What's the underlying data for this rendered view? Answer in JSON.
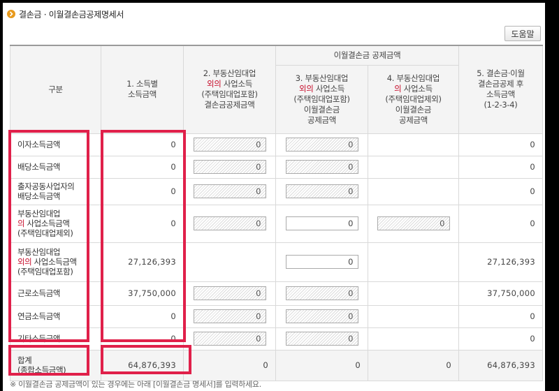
{
  "title": "결손금 · 이월결손금공제명세서",
  "help_label": "도움말",
  "headers": {
    "category": "구분",
    "col1": [
      "1. 소득별",
      "소득금액"
    ],
    "col2": [
      "2. 부동산임대업",
      "외의",
      " 사업소득",
      "(주택임대업포함)",
      "결손금공제금액"
    ],
    "group": "이월결손금 공제금액",
    "col3": [
      "3. 부동산임대업",
      "외의",
      " 사업소득",
      "(주택임대업포함)",
      "이월결손금",
      "공제금액"
    ],
    "col4": [
      "4. 부동산임대업",
      "의",
      " 사업소득",
      "(주택임대업제외)",
      "이월결손금",
      "공제금액"
    ],
    "col5": [
      "5. 결손금·이월",
      "결손금공제 후",
      "소득금액",
      "(1-2-3-4)"
    ]
  },
  "rows": [
    {
      "label": [
        "이자소득금액"
      ],
      "c1": "0",
      "c2": "0",
      "c3": "0",
      "c4": "",
      "c5": "0"
    },
    {
      "label": [
        "배당소득금액"
      ],
      "c1": "0",
      "c2": "0",
      "c3": "0",
      "c4": "",
      "c5": "0"
    },
    {
      "label": [
        "출자공동사업자의",
        "배당소득금액"
      ],
      "c1": "0",
      "c2": "0",
      "c3": "0",
      "c4": "",
      "c5": "0"
    },
    {
      "label": [
        "부동산임대업",
        "의",
        " 사업소득금액",
        "(주택임대업제외)"
      ],
      "c1": "0",
      "c2": "0",
      "c3": "0",
      "c4": "0",
      "c5": "0"
    },
    {
      "label": [
        "부동산임대업",
        "외의",
        " 사업소득금액",
        "(주택임대업포함)"
      ],
      "c1": "27,126,393",
      "c2": "",
      "c3": "0",
      "c4": "",
      "c5": "27,126,393"
    },
    {
      "label": [
        "근로소득금액"
      ],
      "c1": "37,750,000",
      "c2": "0",
      "c3": "0",
      "c4": "",
      "c5": "37,750,000"
    },
    {
      "label": [
        "연금소득금액"
      ],
      "c1": "0",
      "c2": "0",
      "c3": "0",
      "c4": "",
      "c5": "0"
    },
    {
      "label": [
        "기타소득금액"
      ],
      "c1": "0",
      "c2": "0",
      "c3": "0",
      "c4": "",
      "c5": "0"
    }
  ],
  "total": {
    "label": [
      "합계",
      "(종합소득금액)"
    ],
    "c1": "64,876,393",
    "c2": "0",
    "c3": "0",
    "c4": "0",
    "c5": "64,876,393"
  },
  "footnote": "※ 이월결손금 공제금액이 있는 경우에는 아래 [이월결손금 명세서]를 입력하세요.",
  "colors": {
    "highlight_box": "#e0204a",
    "accent_text": "#c8102e",
    "title_icon": "#e89a1c"
  }
}
